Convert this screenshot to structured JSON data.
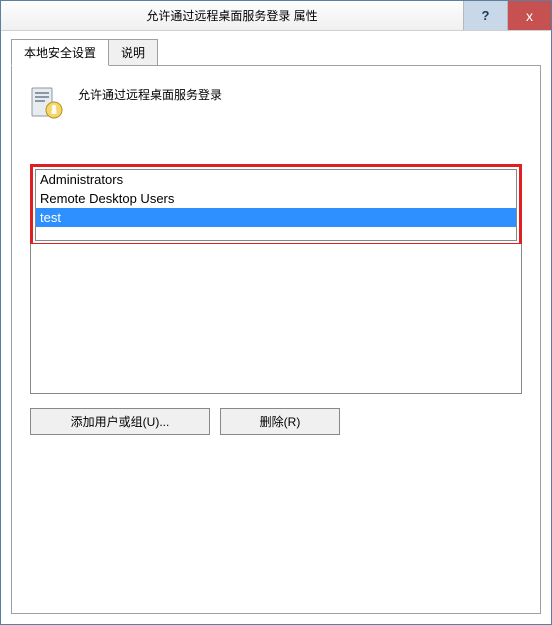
{
  "window": {
    "title": "允许通过远程桌面服务登录 属性",
    "help_symbol": "?",
    "close_symbol": "x"
  },
  "tabs": [
    {
      "label": "本地安全设置",
      "active": true
    },
    {
      "label": "说明",
      "active": false
    }
  ],
  "policy": {
    "title": "允许通过远程桌面服务登录"
  },
  "users": {
    "items": [
      {
        "label": "Administrators",
        "selected": false
      },
      {
        "label": "Remote Desktop Users",
        "selected": false
      },
      {
        "label": "test",
        "selected": true
      }
    ]
  },
  "buttons": {
    "add": "添加用户或组(U)...",
    "remove": "删除(R)"
  }
}
